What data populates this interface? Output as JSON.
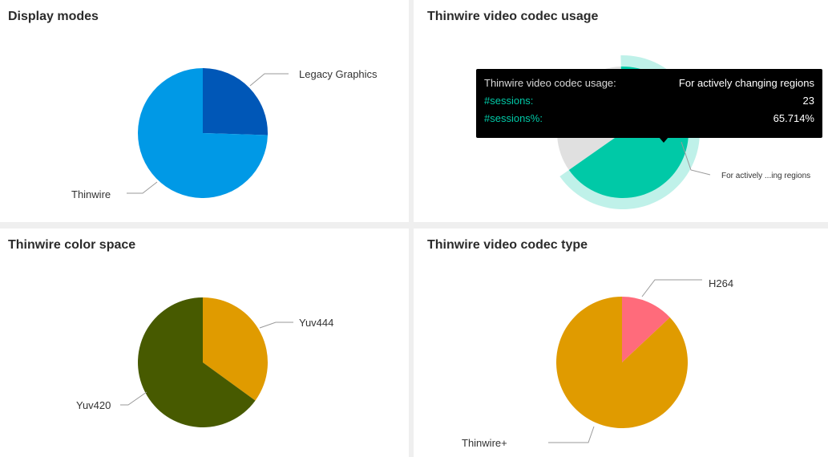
{
  "colors": {
    "legacy_graphics": "#0057b7",
    "thinwire": "#0099e6",
    "for_actively_changing_regions": "#00c9a7",
    "other_codec_usage": "#e0e0e0",
    "yuv444": "#e09b00",
    "yuv420": "#475a00",
    "h264": "#ff6b7b",
    "thinwire_plus": "#e09b00",
    "tooltip_accent": "#00c9a7"
  },
  "chart_data": [
    {
      "type": "pie",
      "title": "Display modes",
      "slices": [
        {
          "label": "Legacy Graphics",
          "value": 25.5
        },
        {
          "label": "Thinwire",
          "value": 74.5
        }
      ]
    },
    {
      "type": "pie",
      "title": "Thinwire video codec usage",
      "slices": [
        {
          "label": "For actively ...ing regions",
          "full_label": "For actively changing regions",
          "value": 65.714,
          "sessions": 23
        },
        {
          "label": "",
          "value": 34.286
        }
      ]
    },
    {
      "type": "pie",
      "title": "Thinwire color space",
      "slices": [
        {
          "label": "Yuv444",
          "value": 35
        },
        {
          "label": "Yuv420",
          "value": 65
        }
      ]
    },
    {
      "type": "pie",
      "title": "Thinwire video codec type",
      "slices": [
        {
          "label": "H264",
          "value": 13
        },
        {
          "label": "Thinwire+",
          "value": 87
        }
      ]
    }
  ],
  "tooltip": {
    "header_key": "Thinwire video codec usage:",
    "header_value": "For actively changing regions",
    "rows": [
      {
        "key": "#sessions:",
        "value": "23"
      },
      {
        "key": "#sessions%:",
        "value": "65.714%"
      }
    ]
  }
}
